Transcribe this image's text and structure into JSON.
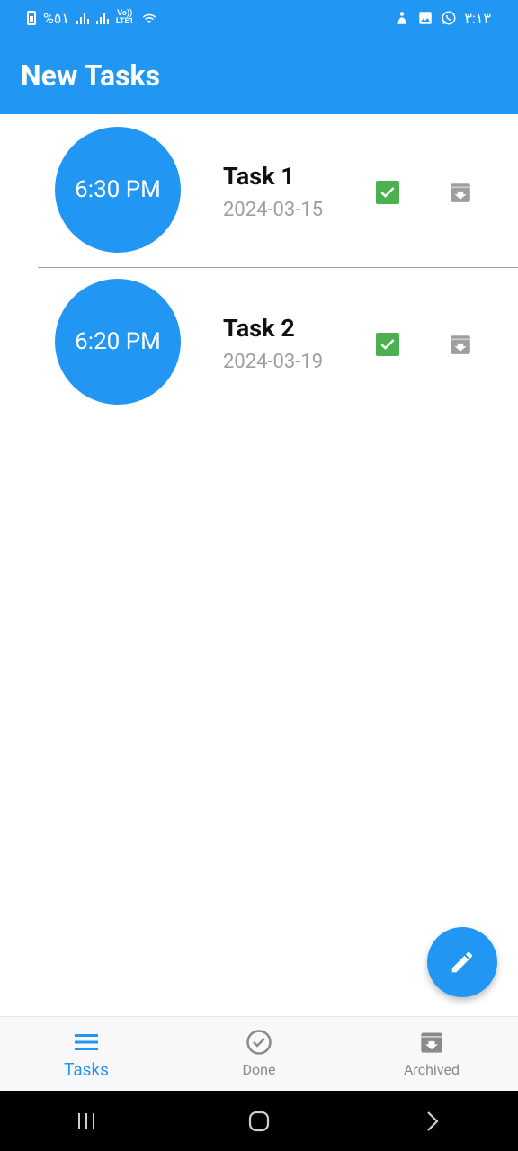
{
  "status_bar": {
    "battery_text": "%٥١",
    "volte_text_top": "Vo))",
    "volte_text_bottom": "LTE1",
    "time": "٣:١٣"
  },
  "app_bar": {
    "title": "New Tasks"
  },
  "tasks": [
    {
      "time": "6:30 PM",
      "title": "Task 1",
      "date": "2024-03-15"
    },
    {
      "time": "6:20 PM",
      "title": "Task 2",
      "date": "2024-03-19"
    }
  ],
  "bottom_nav": {
    "items": [
      {
        "label": "Tasks",
        "icon": "menu-icon",
        "active": true
      },
      {
        "label": "Done",
        "icon": "check-circle-icon",
        "active": false
      },
      {
        "label": "Archived",
        "icon": "archive-icon",
        "active": false
      }
    ]
  },
  "colors": {
    "primary": "#2196F3",
    "done_green": "#4CAF50",
    "archive_grey": "#9e9e9e",
    "date_grey": "#9e9e9e"
  }
}
